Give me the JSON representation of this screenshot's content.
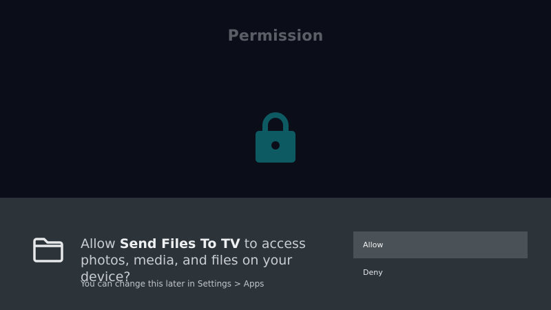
{
  "header": {
    "title": "Permission"
  },
  "icons": {
    "lock": "lock-icon",
    "folder": "folder-icon"
  },
  "dialog": {
    "prompt_prefix": "Allow ",
    "app_name": "Send Files To TV",
    "prompt_suffix": " to access photos, media, and files on your device?",
    "hint": "You can change this later in Settings > Apps",
    "buttons": {
      "allow": "Allow",
      "deny": "Deny"
    }
  },
  "colors": {
    "background": "#0b0e19",
    "sheet": "#2c343a",
    "lock": "#0e5a63",
    "selected_button": "#4b5257"
  }
}
